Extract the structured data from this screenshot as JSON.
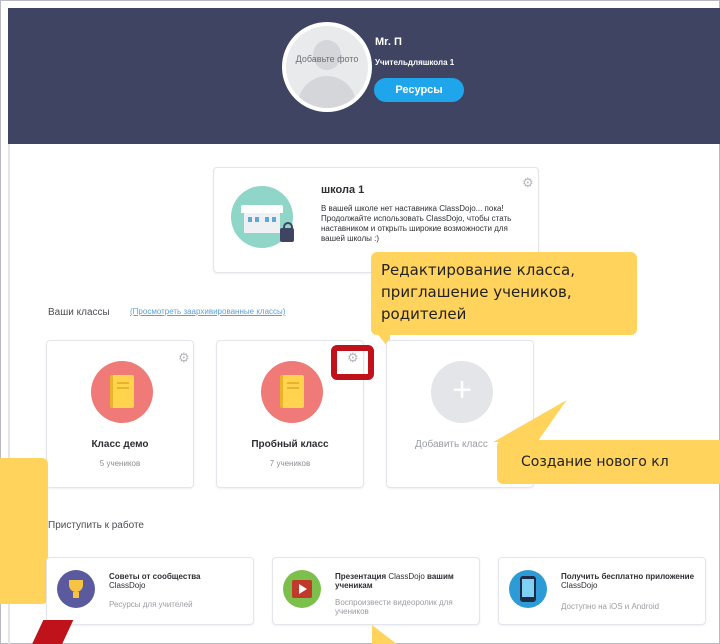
{
  "header": {
    "avatar_caption": "Добавьте фото",
    "teacher_name": "Mr. П",
    "school_subtitle": "Учительдляшкола 1",
    "resources_button": "Ресурсы"
  },
  "school_card": {
    "title": "школа 1",
    "description": "В вашей школе нет наставника ClassDojo... пока! Продолжайте использовать ClassDojo, чтобы стать наставником и открыть широкие возможности для вашей школы :)"
  },
  "classes": {
    "heading": "Ваши классы",
    "archived_link": "(Просмотреть заархивированные классы)",
    "items": [
      {
        "name": "Класс демо",
        "count": "5 учеников"
      },
      {
        "name": "Пробный класс",
        "count": "7 учеников"
      }
    ],
    "add_label": "Добавить класс"
  },
  "callouts": {
    "edit_class": "Редактирование класса, приглашение учеников, родителей",
    "new_class": "Создание нового кл"
  },
  "get_started": {
    "heading": "Приступить к работе",
    "tiles": [
      {
        "title": "Советы от сообщества",
        "title_reg": "ClassDojo",
        "subtitle": "Ресурсы для учителей"
      },
      {
        "title": "Презентация",
        "title_reg": "ClassDojo",
        "title_end": "вашим ученикам",
        "subtitle": "Воспроизвести видеоролик для учеников"
      },
      {
        "title": "Получить бесплатно приложение",
        "title_reg": "ClassDojo",
        "subtitle": "Доступно на iOS и Android"
      }
    ]
  },
  "colors": {
    "header_bg": "#3f4463",
    "accent_blue": "#1fa5ec",
    "class_icon": "#f07a78",
    "callout": "#ffd35c",
    "highlight_red": "#c0121a"
  },
  "icons": [
    "gear-icon",
    "plus-icon",
    "book-icon",
    "school-building-icon",
    "lock-icon",
    "trophy-icon",
    "video-icon",
    "phone-icon"
  ]
}
